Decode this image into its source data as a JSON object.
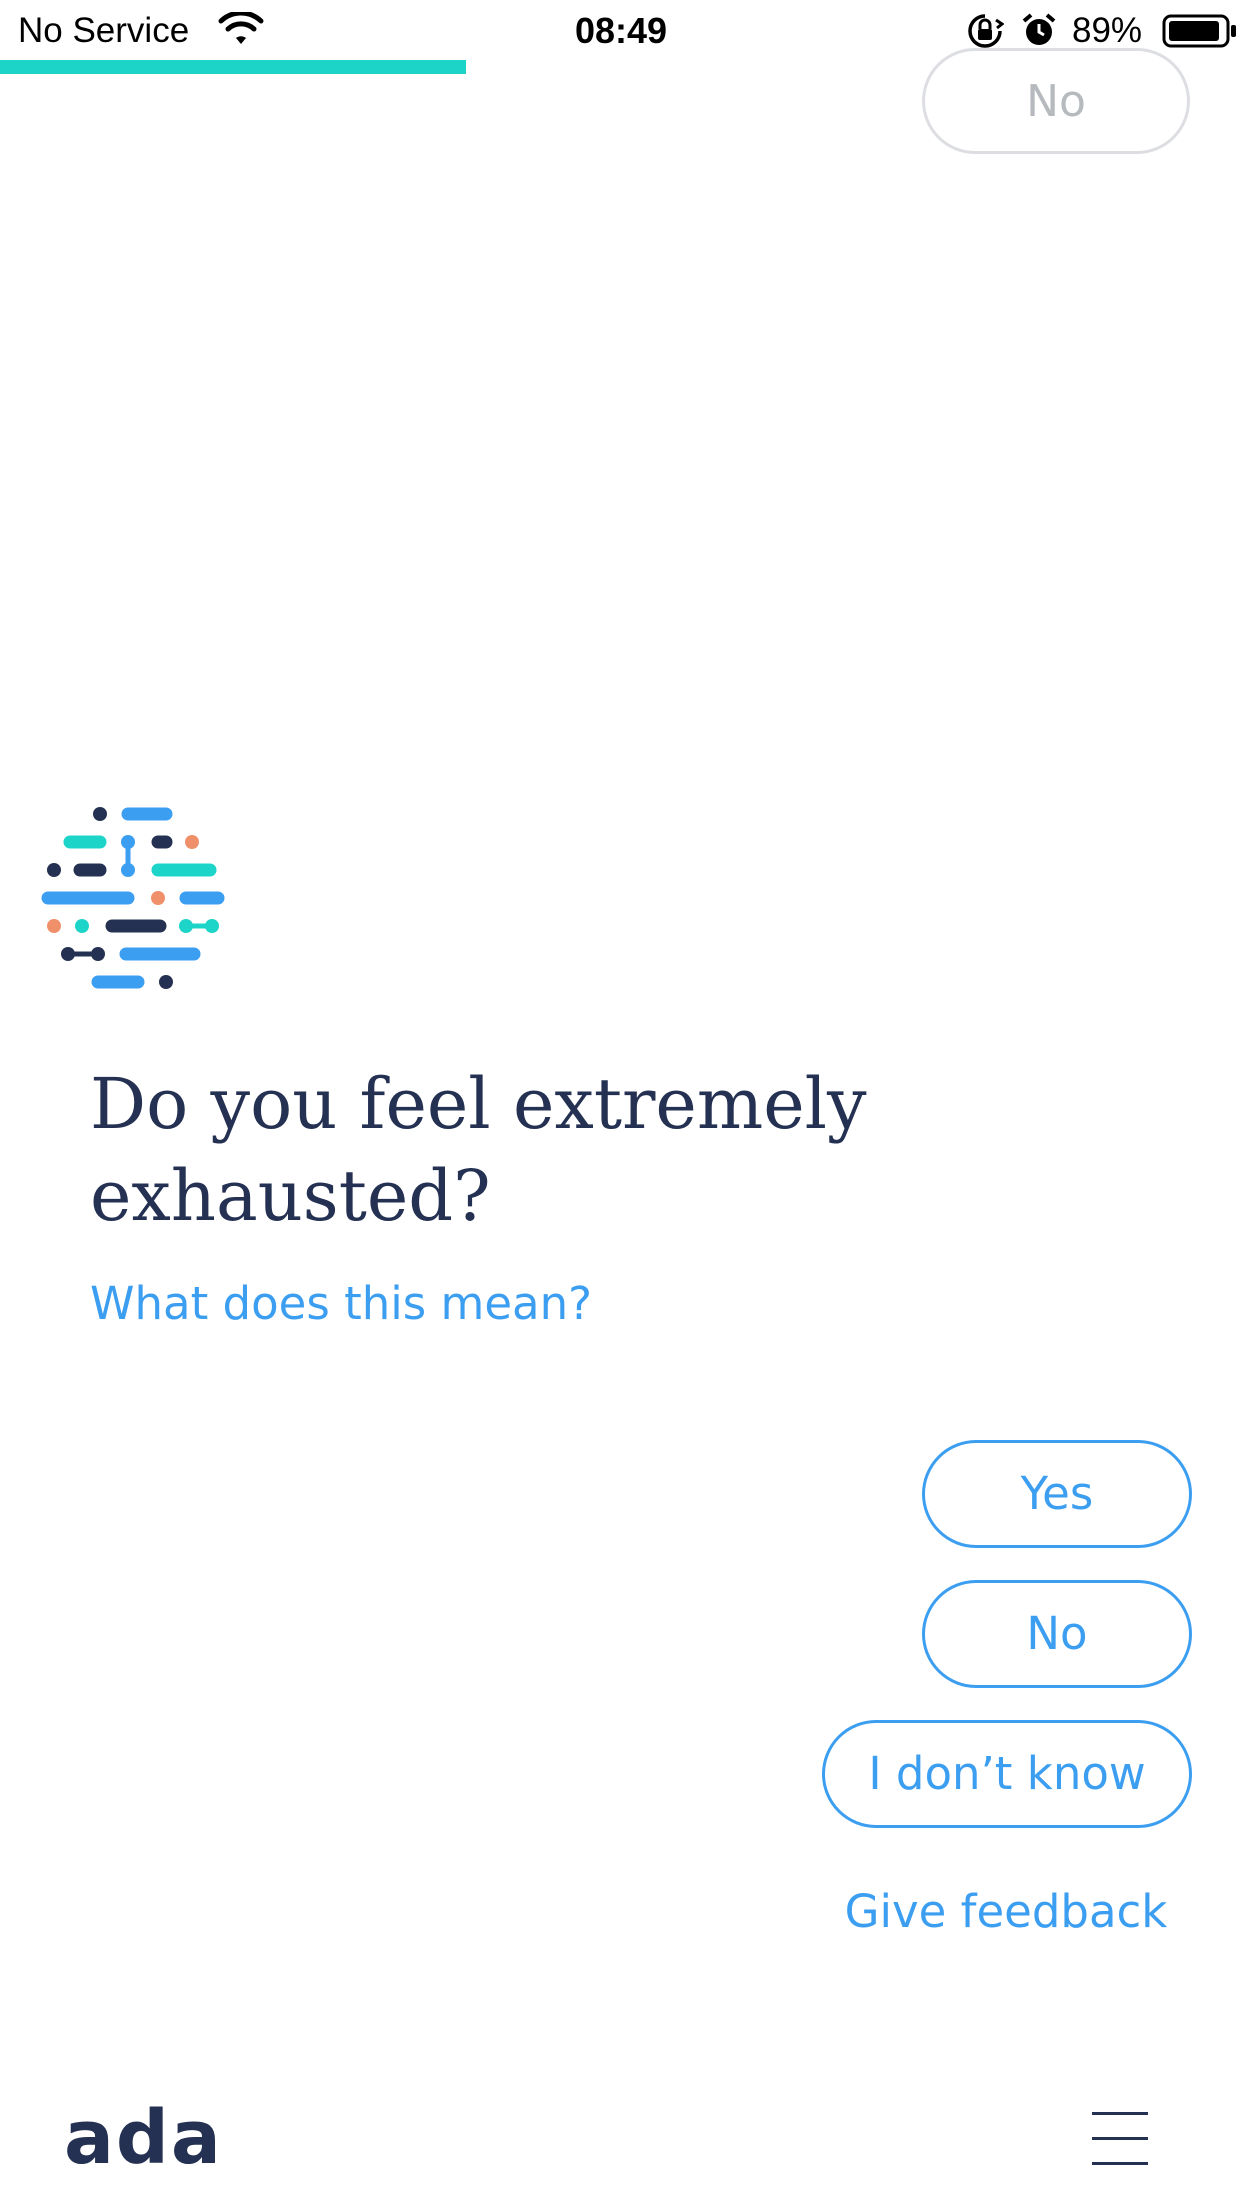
{
  "status_bar": {
    "carrier": "No Service",
    "time": "08:49",
    "battery_percent": "89%",
    "icons": [
      "wifi-icon",
      "rotation-lock-icon",
      "alarm-icon",
      "battery-icon"
    ]
  },
  "progress": {
    "fraction": 0.375,
    "color": "#1dd4c8"
  },
  "previous_answer": {
    "label": "No"
  },
  "question": {
    "text": "Do you feel extremely exhausted?",
    "explain_link": "What does this mean?"
  },
  "answers": {
    "yes": "Yes",
    "no": "No",
    "dont_know": "I don’t know"
  },
  "feedback_link": "Give feedback",
  "footer": {
    "logo": "ada",
    "menu_icon": "hamburger-menu-icon"
  },
  "colors": {
    "accent": "#3c9ef0",
    "teal": "#1dd4c8",
    "navy": "#253152",
    "coral": "#f0906a"
  }
}
